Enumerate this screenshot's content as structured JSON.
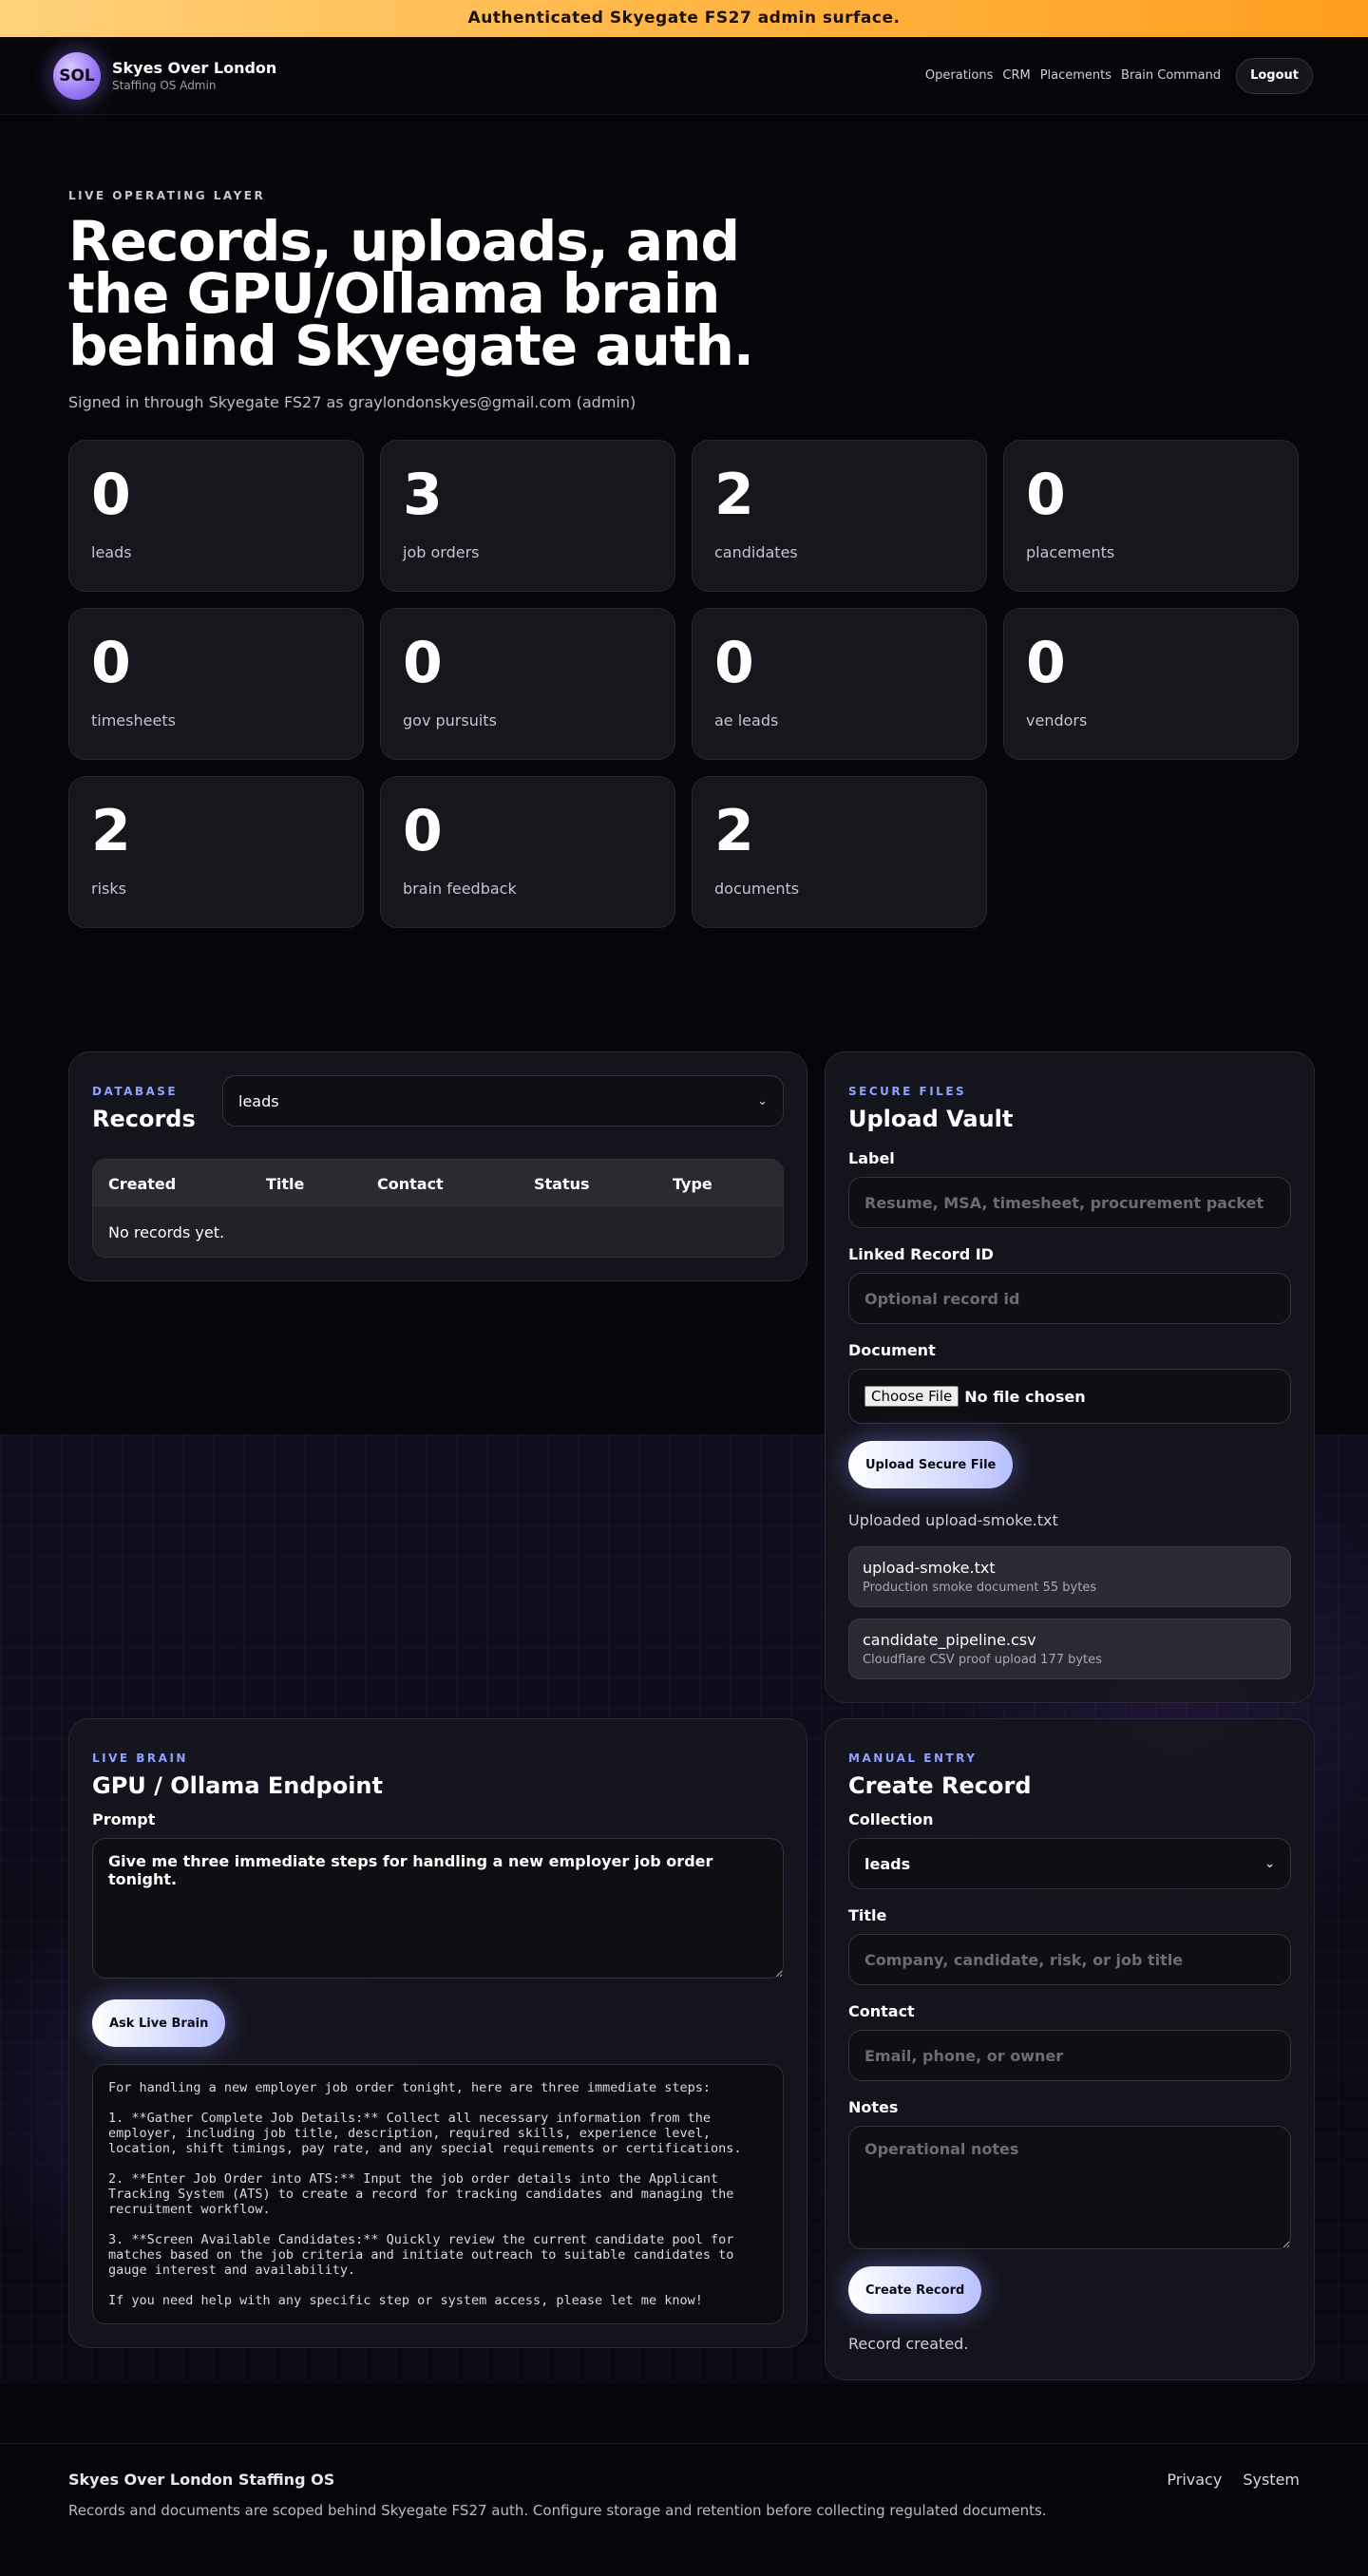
{
  "banner": "Authenticated Skyegate FS27 admin surface.",
  "brand": {
    "logo": "SOL",
    "name": "Skyes Over London",
    "sub": "Staffing OS Admin"
  },
  "nav": {
    "operations": "Operations",
    "crm": "CRM",
    "placements": "Placements",
    "brain": "Brain Command",
    "logout": "Logout"
  },
  "hero": {
    "eyebrow": "LIVE OPERATING LAYER",
    "title": "Records, uploads, and the GPU/Ollama brain behind Skyegate auth.",
    "signed": "Signed in through Skyegate FS27 as graylondonskyes@gmail.com (admin)"
  },
  "stats": [
    {
      "value": "0",
      "label": "leads"
    },
    {
      "value": "3",
      "label": "job orders"
    },
    {
      "value": "2",
      "label": "candidates"
    },
    {
      "value": "0",
      "label": "placements"
    },
    {
      "value": "0",
      "label": "timesheets"
    },
    {
      "value": "0",
      "label": "gov pursuits"
    },
    {
      "value": "0",
      "label": "ae leads"
    },
    {
      "value": "0",
      "label": "vendors"
    },
    {
      "value": "2",
      "label": "risks"
    },
    {
      "value": "0",
      "label": "brain feedback"
    },
    {
      "value": "2",
      "label": "documents"
    }
  ],
  "records": {
    "eyebrow": "DATABASE",
    "title": "Records",
    "select_value": "leads",
    "columns": [
      "Created",
      "Title",
      "Contact",
      "Status",
      "Type"
    ],
    "empty": "No records yet."
  },
  "vault": {
    "eyebrow": "SECURE FILES",
    "title": "Upload Vault",
    "label_label": "Label",
    "label_placeholder": "Resume, MSA, timesheet, procurement packet",
    "linked_label": "Linked Record ID",
    "linked_placeholder": "Optional record id",
    "document_label": "Document",
    "choose_file": "Choose File",
    "no_file": "No file chosen",
    "upload_button": "Upload Secure File",
    "status": "Uploaded upload-smoke.txt",
    "files": [
      {
        "name": "upload-smoke.txt",
        "detail": "Production smoke document 55 bytes"
      },
      {
        "name": "candidate_pipeline.csv",
        "detail": "Cloudflare CSV proof upload 177 bytes"
      }
    ]
  },
  "brain": {
    "eyebrow": "LIVE BRAIN",
    "title": "GPU / Ollama Endpoint",
    "prompt_label": "Prompt",
    "prompt_value": "Give me three immediate steps for handling a new employer job order tonight.",
    "ask_button": "Ask Live Brain",
    "output": "For handling a new employer job order tonight, here are three immediate steps:\n\n1. **Gather Complete Job Details:** Collect all necessary information from the employer, including job title, description, required skills, experience level, location, shift timings, pay rate, and any special requirements or certifications.\n\n2. **Enter Job Order into ATS:** Input the job order details into the Applicant Tracking System (ATS) to create a record for tracking candidates and managing the recruitment workflow.\n\n3. **Screen Available Candidates:** Quickly review the current candidate pool for matches based on the job criteria and initiate outreach to suitable candidates to gauge interest and availability.\n\nIf you need help with any specific step or system access, please let me know!"
  },
  "manual": {
    "eyebrow": "MANUAL ENTRY",
    "title": "Create Record",
    "collection_label": "Collection",
    "collection_value": "leads",
    "title_label": "Title",
    "title_placeholder": "Company, candidate, risk, or job title",
    "contact_label": "Contact",
    "contact_placeholder": "Email, phone, or owner",
    "notes_label": "Notes",
    "notes_placeholder": "Operational notes",
    "create_button": "Create Record",
    "status": "Record created."
  },
  "footer": {
    "title": "Skyes Over London Staffing OS",
    "note": "Records and documents are scoped behind Skyegate FS27 auth. Configure storage and retention before collecting regulated documents.",
    "privacy": "Privacy",
    "system": "System"
  }
}
